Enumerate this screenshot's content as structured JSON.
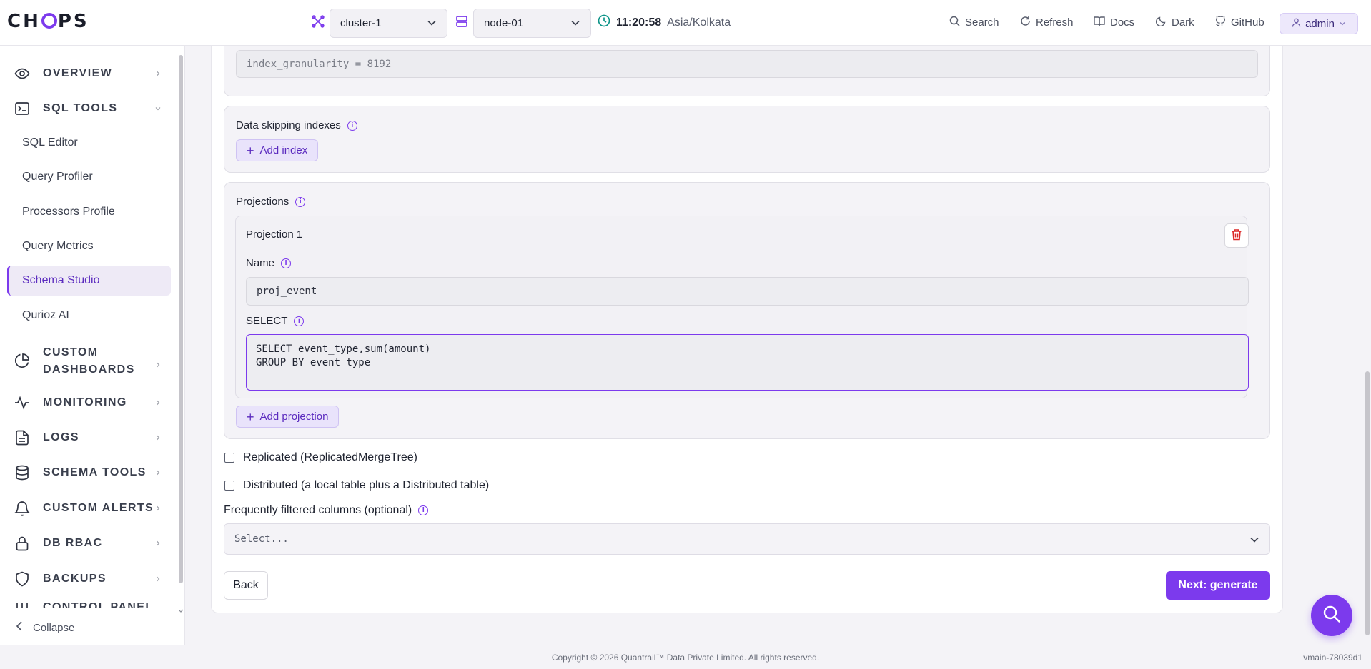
{
  "header": {
    "logo": "CHOPS",
    "cluster": "cluster-1",
    "node": "node-01",
    "time": "11:20:58",
    "timezone": "Asia/Kolkata",
    "links": {
      "search": "Search",
      "refresh": "Refresh",
      "docs": "Docs",
      "dark": "Dark",
      "github": "GitHub"
    },
    "user": "admin"
  },
  "sidebar": {
    "sections": {
      "overview": "OVERVIEW",
      "sql_tools": "SQL TOOLS",
      "custom_dashboards_1": "CUSTOM",
      "custom_dashboards_2": "DASHBOARDS",
      "monitoring": "MONITORING",
      "logs": "LOGS",
      "schema_tools": "SCHEMA TOOLS",
      "custom_alerts": "CUSTOM ALERTS",
      "db_rbac": "DB RBAC",
      "backups": "BACKUPS",
      "partial": "CONTROL PANEL"
    },
    "sub_items": [
      "SQL Editor",
      "Query Profiler",
      "Processors Profile",
      "Query Metrics",
      "Schema Studio",
      "Qurioz AI"
    ],
    "active": "Schema Studio",
    "collapse": "Collapse"
  },
  "form": {
    "settings_value": "index_granularity = 8192",
    "data_skipping_label": "Data skipping indexes",
    "add_index": "Add index",
    "projections_label": "Projections",
    "projection_title": "Projection 1",
    "name_label": "Name",
    "name_value": "proj_event",
    "select_label": "SELECT",
    "select_value": "SELECT event_type,sum(amount)\nGROUP BY event_type",
    "add_projection": "Add projection",
    "replicated_label": "Replicated (ReplicatedMergeTree)",
    "distributed_label": "Distributed (a local table plus a Distributed table)",
    "filtered_label": "Frequently filtered columns (optional)",
    "filtered_placeholder": "Select...",
    "back": "Back",
    "next": "Next: generate"
  },
  "footer": {
    "copyright": "Copyright © 2026 Quantrail™ Data Private Limited. All rights reserved.",
    "version": "vmain-78039d1"
  },
  "colors": {
    "accent": "#7c3aed",
    "accent_soft": "#e9e3fb",
    "danger": "#dc2626"
  }
}
